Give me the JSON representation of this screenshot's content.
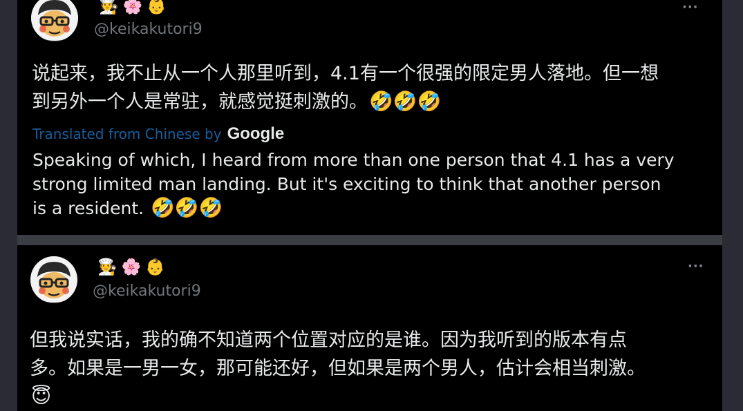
{
  "tweets": [
    {
      "name_emojis": [
        "🧑‍🍳",
        "🌸",
        "👶"
      ],
      "handle": "@keikakutori9",
      "more_label": "···",
      "text_lines": [
        "说起来，我不止从一个人那里听到，4.1有一个很强的限定男人落地。但一想",
        "到另外一个人是常驻，就感觉挺刺激的。"
      ],
      "text_emojis": "🤣🤣🤣",
      "translated_from": "Translated from Chinese by",
      "translator": "Google",
      "translation_lines": [
        "Speaking of which, I heard from more than one person that 4.1 has a very",
        "strong limited man landing. But it's exciting to think that another person",
        "is a resident."
      ],
      "translation_emojis": "🤣🤣🤣"
    },
    {
      "name_emojis": [
        "🧑‍🍳",
        "🌸",
        "👶"
      ],
      "handle": "@keikakutori9",
      "more_label": "···",
      "text_lines": [
        "但我说实话，我的确不知道两个位置对应的是谁。因为我听到的版本有点",
        "多。如果是一男一女，那可能还好，但如果是两个男人，估计会相当刺激。"
      ],
      "text_emojis": "😇"
    }
  ],
  "colors": {
    "page_background": "#2b2b35",
    "card_background": "#000000",
    "text_primary": "#e7e9ea",
    "text_secondary": "#71767b",
    "link": "#1d6fb8"
  }
}
